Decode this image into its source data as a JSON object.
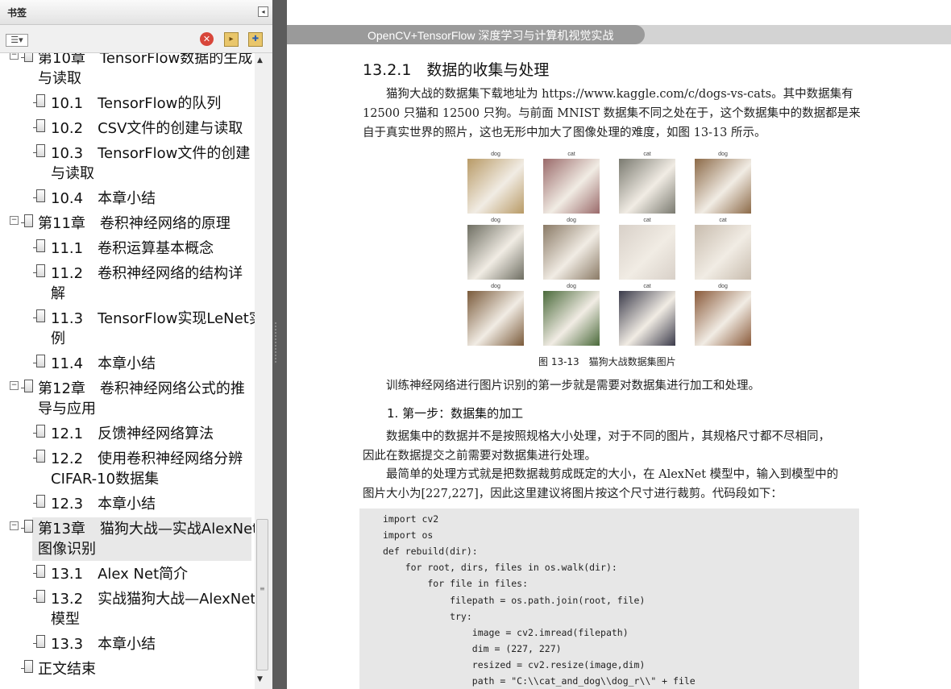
{
  "sidebar": {
    "title": "书签",
    "collapse_icon": "◂",
    "toolbar": {
      "options_label": "☰▾",
      "delete_label": "✕",
      "expand_label": "▸",
      "new_bookmark_label": "✚"
    },
    "toggle_symbol": "−",
    "items": [
      {
        "level": 1,
        "lines": [
          "第10章　TensorFlow数据的生成",
          "与读取"
        ],
        "toggle": true
      },
      {
        "level": 2,
        "lines": [
          "10.1　TensorFlow的队列"
        ]
      },
      {
        "level": 2,
        "lines": [
          "10.2　CSV文件的创建与读取"
        ]
      },
      {
        "level": 2,
        "lines": [
          "10.3　TensorFlow文件的创建",
          "与读取"
        ]
      },
      {
        "level": 2,
        "lines": [
          "10.4　本章小结"
        ]
      },
      {
        "level": 1,
        "lines": [
          "第11章　卷积神经网络的原理"
        ],
        "toggle": true
      },
      {
        "level": 2,
        "lines": [
          "11.1　卷积运算基本概念"
        ]
      },
      {
        "level": 2,
        "lines": [
          "11.2　卷积神经网络的结构详",
          "解"
        ]
      },
      {
        "level": 2,
        "lines": [
          "11.3　TensorFlow实现LeNet实",
          "例"
        ]
      },
      {
        "level": 2,
        "lines": [
          "11.4　本章小结"
        ]
      },
      {
        "level": 1,
        "lines": [
          "第12章　卷积神经网络公式的推",
          "导与应用"
        ],
        "toggle": true
      },
      {
        "level": 2,
        "lines": [
          "12.1　反馈神经网络算法"
        ]
      },
      {
        "level": 2,
        "lines": [
          "12.2　使用卷积神经网络分辨",
          "CIFAR-10数据集"
        ]
      },
      {
        "level": 2,
        "lines": [
          "12.3　本章小结"
        ]
      },
      {
        "level": 1,
        "lines": [
          "第13章　猫狗大战—实战AlexNet",
          "图像识别"
        ],
        "toggle": true,
        "selected": true
      },
      {
        "level": 2,
        "lines": [
          "13.1　Alex Net简介"
        ]
      },
      {
        "level": 2,
        "lines": [
          "13.2　实战猫狗大战—AlexNet",
          "模型"
        ]
      },
      {
        "level": 2,
        "lines": [
          "13.3　本章小结"
        ]
      },
      {
        "level": 1,
        "lines": [
          "正文结束"
        ],
        "toggle": false
      }
    ]
  },
  "document": {
    "running_head": "OpenCV+TensorFlow 深度学习与计算机视觉实战",
    "section_title": "13.2.1　数据的收集与处理",
    "para1": [
      "猫狗大战的数据集下载地址为 https://www.kaggle.com/c/dogs-vs-cats。其中数据集有",
      "12500 只猫和 12500 只狗。与前面 MNIST 数据集不同之处在于，这个数据集中的数据都是来",
      "自于真实世界的照片，这也无形中加大了图像处理的难度，如图 13-13 所示。"
    ],
    "figure": {
      "labels": [
        "dog",
        "cat",
        "cat",
        "dog",
        "dog",
        "dog",
        "cat",
        "cat",
        "dog",
        "dog",
        "cat",
        "dog"
      ],
      "caption": "图 13-13　猫狗大战数据集图片"
    },
    "para2": "训练神经网络进行图片识别的第一步就是需要对数据集进行加工和处理。",
    "step1": "1. 第一步：数据集的加工",
    "para3": [
      "数据集中的数据并不是按照规格大小处理，对于不同的图片，其规格尺寸都不尽相同，",
      "因此在数据提交之前需要对数据集进行处理。"
    ],
    "para4": [
      "最简单的处理方式就是把数据裁剪成既定的大小，在 AlexNet 模型中，输入到模型中的",
      "图片大小为[227,227]，因此这里建议将图片按这个尺寸进行裁剪。代码段如下："
    ],
    "code": [
      "import cv2",
      "import os",
      "def rebuild(dir):",
      "    for root, dirs, files in os.walk(dir):",
      "        for file in files:",
      "            filepath = os.path.join(root, file)",
      "            try:",
      "                image = cv2.imread(filepath)",
      "                dim = (227, 227)",
      "                resized = cv2.resize(image,dim)",
      "                path = \"C:\\\\cat_and_dog\\\\dog_r\\\\\" + file"
    ]
  },
  "colors": {
    "photo_tones": [
      "#b89a66",
      "#9a6a6a",
      "#7a7a70",
      "#8c6a48",
      "#6e6e62",
      "#8a7a66",
      "#d8d0c8",
      "#c8bcae",
      "#7a5a3a",
      "#4a6a3a",
      "#3a3a4a",
      "#8a5a3a"
    ]
  }
}
